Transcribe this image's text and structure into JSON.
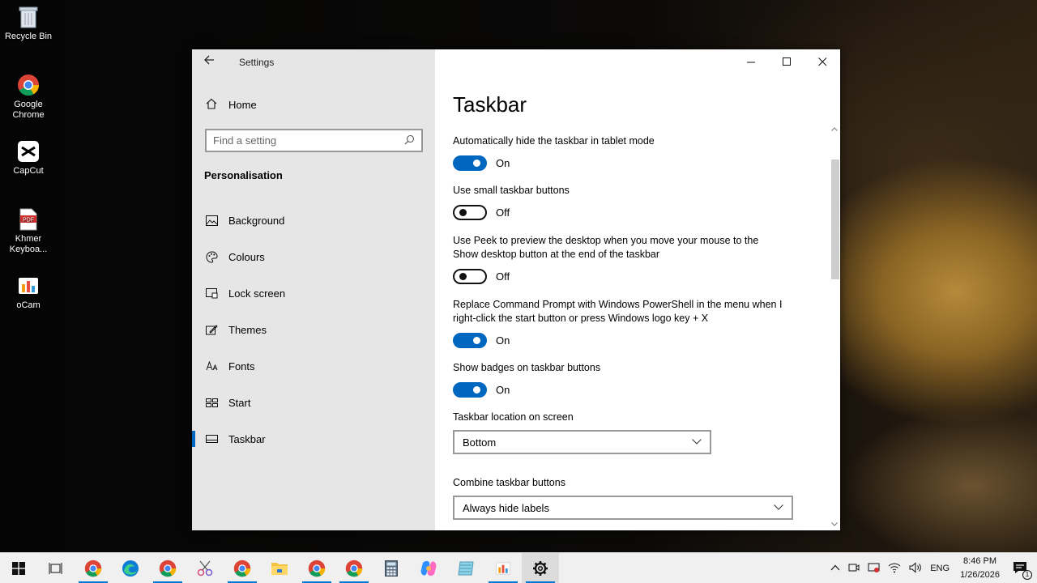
{
  "desktop": {
    "icons": [
      {
        "label": "Recycle Bin",
        "icon": "recycle-bin-icon"
      },
      {
        "label": "Google Chrome",
        "icon": "chrome-icon"
      },
      {
        "label": "CapCut",
        "icon": "capcut-icon"
      },
      {
        "label": "Khmer Keyboa...",
        "icon": "pdf-icon"
      },
      {
        "label": "oCam",
        "icon": "ocam-icon"
      }
    ]
  },
  "window": {
    "title": "Settings",
    "controls": {
      "minimize": "—",
      "maximize": "☐",
      "close": "✕"
    }
  },
  "sidebar": {
    "home": "Home",
    "search_placeholder": "Find a setting",
    "section": "Personalisation",
    "items": [
      {
        "label": "Background",
        "icon": "picture-icon"
      },
      {
        "label": "Colours",
        "icon": "palette-icon"
      },
      {
        "label": "Lock screen",
        "icon": "lock-screen-icon"
      },
      {
        "label": "Themes",
        "icon": "themes-icon"
      },
      {
        "label": "Fonts",
        "icon": "fonts-icon"
      },
      {
        "label": "Start",
        "icon": "start-icon"
      },
      {
        "label": "Taskbar",
        "icon": "taskbar-icon",
        "active": true
      }
    ]
  },
  "main": {
    "title": "Taskbar",
    "settings": [
      {
        "label": "Automatically hide the taskbar in tablet mode",
        "state": "On",
        "on": true
      },
      {
        "label": "Use small taskbar buttons",
        "state": "Off",
        "on": false
      },
      {
        "label": "Use Peek to preview the desktop when you move your mouse to the Show desktop button at the end of the taskbar",
        "state": "Off",
        "on": false
      },
      {
        "label": "Replace Command Prompt with Windows PowerShell in the menu when I right-click the start button or press Windows logo key + X",
        "state": "On",
        "on": true
      },
      {
        "label": "Show badges on taskbar buttons",
        "state": "On",
        "on": true
      }
    ],
    "location": {
      "label": "Taskbar location on screen",
      "value": "Bottom"
    },
    "combine": {
      "label": "Combine taskbar buttons",
      "value": "Always hide labels"
    }
  },
  "taskbar": {
    "language": "ENG",
    "time": "8:46 PM",
    "date": "1/26/2026",
    "notification_count": "1",
    "colors": {
      "accent": "#0067c0",
      "running_indicator": "#0078d4"
    }
  }
}
